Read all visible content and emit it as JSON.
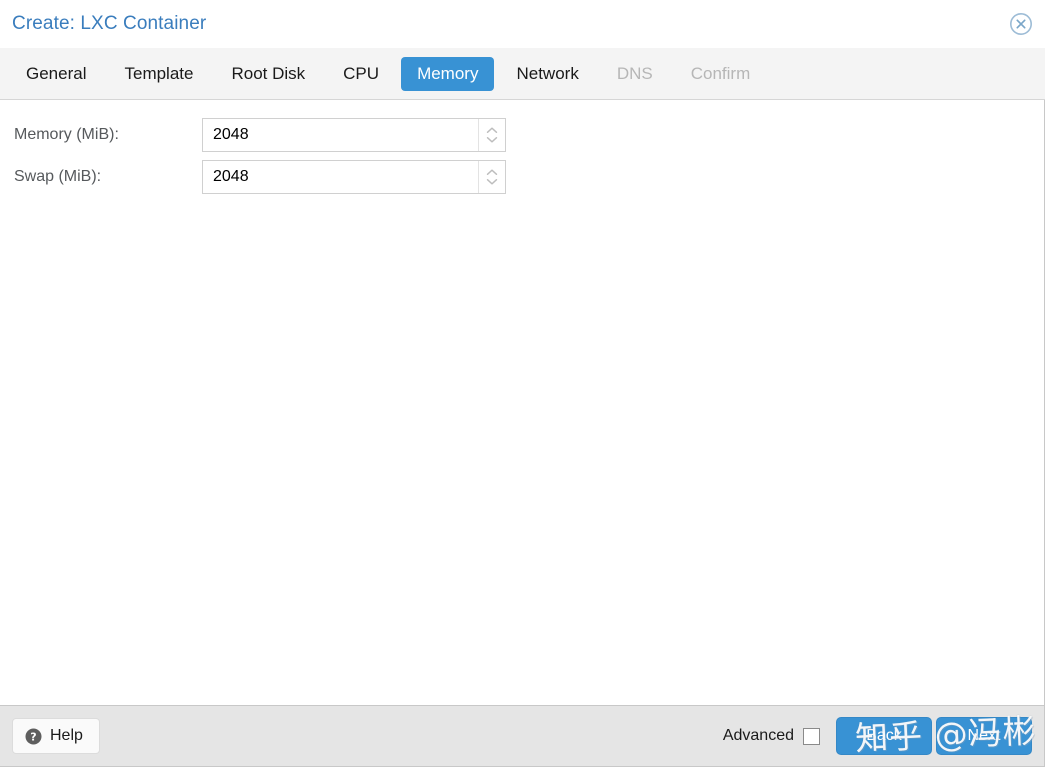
{
  "window": {
    "title": "Create: LXC Container",
    "close_icon": "close-circle-icon",
    "accent_color": "#3892d4",
    "title_color": "#3a7dbd"
  },
  "tabs": [
    {
      "label": "General",
      "state": "normal"
    },
    {
      "label": "Template",
      "state": "normal"
    },
    {
      "label": "Root Disk",
      "state": "normal"
    },
    {
      "label": "CPU",
      "state": "normal"
    },
    {
      "label": "Memory",
      "state": "active"
    },
    {
      "label": "Network",
      "state": "normal"
    },
    {
      "label": "DNS",
      "state": "disabled"
    },
    {
      "label": "Confirm",
      "state": "disabled"
    }
  ],
  "form": {
    "fields": [
      {
        "label": "Memory (MiB):",
        "value": "2048",
        "placeholder": "",
        "spinner_up_icon": "chevron-up-icon",
        "spinner_down_icon": "chevron-down-icon"
      },
      {
        "label": "Swap (MiB):",
        "value": "2048",
        "placeholder": "",
        "spinner_up_icon": "chevron-up-icon",
        "spinner_down_icon": "chevron-down-icon"
      }
    ]
  },
  "footer": {
    "help_label": "Help",
    "help_icon": "question-circle-icon",
    "advanced_label": "Advanced",
    "advanced_checked": false,
    "back_label": "Back",
    "next_label": "Next"
  },
  "watermark": {
    "text": "知乎 @冯彬"
  }
}
